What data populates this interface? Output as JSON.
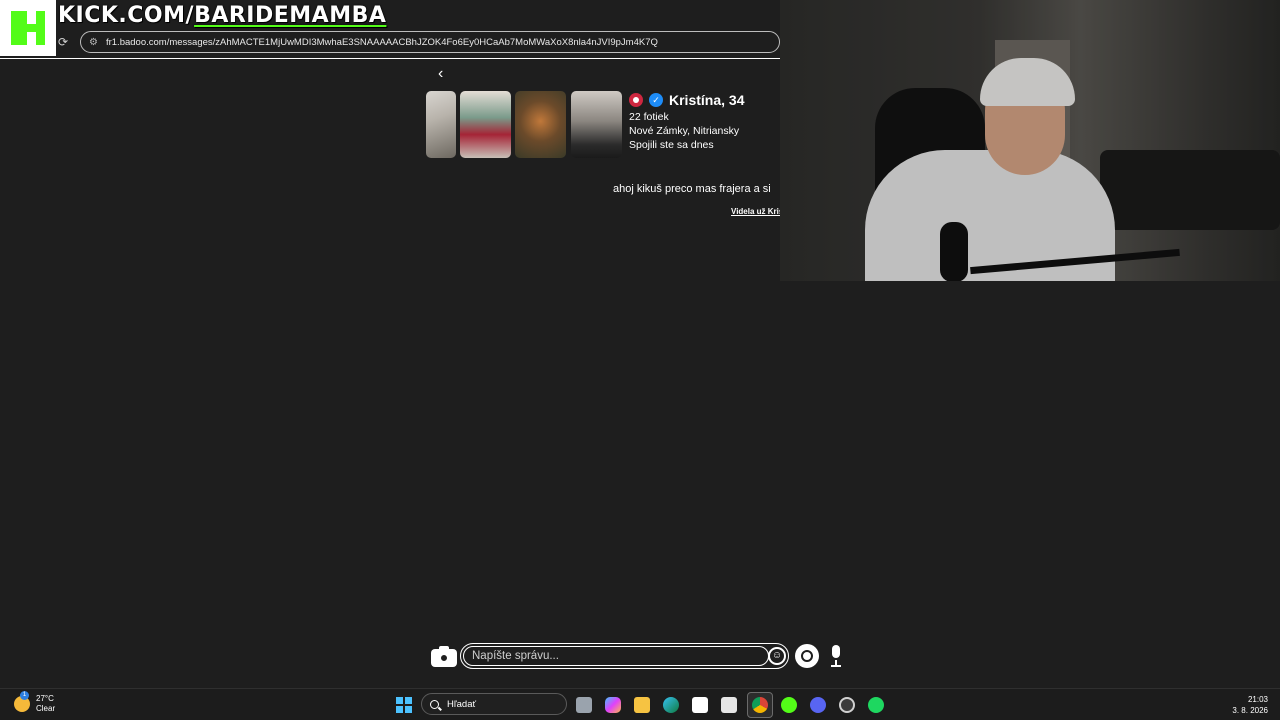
{
  "overlay": {
    "site": "KICK.COM/",
    "handle": "BARIDEMAMBA"
  },
  "browser": {
    "url": "fr1.badoo.com/messages/zAhMACTE1MjUwMDI3MwhaE3SNAAAAACBhJZOK4Fo6Ey0HCaAb7MoMWaXoX8nla4nJVI9pJm4K7Q"
  },
  "chat": {
    "profile": {
      "name": "Kristína, 34",
      "photos_count": "22 fotiek",
      "location": "Nové Zámky, Nitriansky",
      "matched": "Spojili ste sa dnes"
    },
    "message": "ahoj kikuš preco mas frajera a si",
    "seen": "Videla už Kristína"
  },
  "composer": {
    "placeholder": "Napíšte správu..."
  },
  "taskbar": {
    "weather_temp": "27°C",
    "weather_desc": "Clear",
    "search_label": "Hľadať",
    "time": "21:03",
    "date": "3. 8. 2026",
    "icons": [
      "task-view-icon",
      "copilot-icon",
      "file-explorer-icon",
      "edge-icon",
      "store-icon",
      "outlook-icon",
      "chrome-icon",
      "kick-icon",
      "discord-icon",
      "obs-icon",
      "spotify-icon"
    ]
  },
  "colors": {
    "background": "#1e1e1e",
    "kick_green": "#53fc18",
    "badoo_red": "#ce2740",
    "verified_blue": "#1d8cf8",
    "start_blue": "#4cc2ff"
  }
}
